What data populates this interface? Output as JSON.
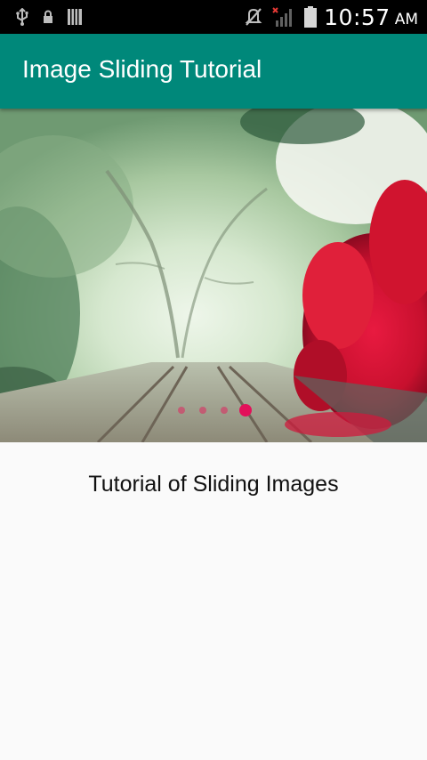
{
  "status_bar": {
    "time": "10:57",
    "ampm": "AM",
    "icons": [
      "usb-icon",
      "lock-icon",
      "barcode-icon",
      "mute-icon",
      "signal-icon",
      "battery-icon"
    ]
  },
  "toolbar": {
    "title": "Image Sliding Tutorial",
    "color": "#00887a"
  },
  "slider": {
    "image": "misty-railway-with-red-flowers",
    "page_count": 4,
    "current_page": 4,
    "indicator_color": "#e3105a"
  },
  "content": {
    "caption": "Tutorial of Sliding Images"
  }
}
